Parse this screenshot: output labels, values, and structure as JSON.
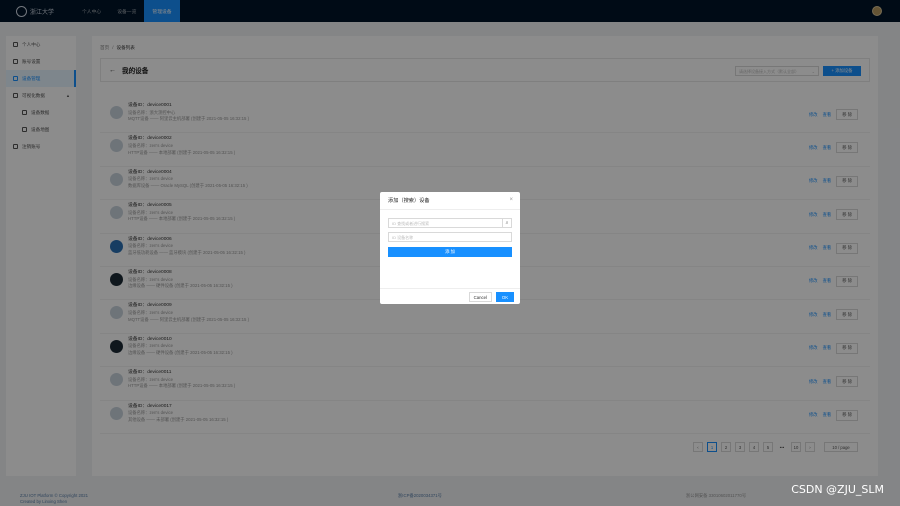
{
  "nav": {
    "logo_text": "浙江大学",
    "items": [
      "个人中心",
      "设备一览",
      "管理设备"
    ]
  },
  "sidebar": {
    "items": [
      {
        "label": "个人中心"
      },
      {
        "label": "账号设置"
      },
      {
        "label": "设备管理"
      },
      {
        "label": "可视化数据"
      },
      {
        "label": "设备数据"
      },
      {
        "label": "设备地图"
      },
      {
        "label": "注销账号"
      }
    ]
  },
  "breadcrumb": {
    "home": "首页",
    "sep": "/",
    "current": "设备列表"
  },
  "header": {
    "title": "我的设备",
    "select_placeholder": "请选择设备接入方式（默认全部）",
    "add_button": "+ 添加设备"
  },
  "device_rows": [
    {
      "title": "设备ID：device0001",
      "line1": "设备名称：浙大测控中心",
      "line2": "MQTT设备 —— 阿里云主机部署 (创建于 2021-05-05 16:32:15 )"
    },
    {
      "title": "设备ID：device0002",
      "line1": "设备名称：zen's device",
      "line2": "HTTP设备 —— 本地部署 (创建于 2021-05-05 16:32:15 )"
    },
    {
      "title": "设备ID：device0004",
      "line1": "设备名称：zen's device",
      "line2": "数据库设备 —— Oracle MySQL (创建于 2021-05-05 16:32:15 )"
    },
    {
      "title": "设备ID：device0005",
      "line1": "设备名称：zen's device",
      "line2": "HTTP设备 —— 本地部署 (创建于 2021-05-05 16:32:15 )"
    },
    {
      "title": "设备ID：device0006",
      "line1": "设备名称：zen's device",
      "line2": "蓝牙低功耗设备 —— 蓝牙模块 (创建于 2021-05-05 16:32:15 )"
    },
    {
      "title": "设备ID：device0008",
      "line1": "设备名称：zen's device",
      "line2": "边缘设备 —— 硬件设备 (创建于 2021-05-05 16:32:15 )"
    },
    {
      "title": "设备ID：device0009",
      "line1": "设备名称：zen's device",
      "line2": "MQTT设备 —— 阿里云主机部署 (创建于 2021-05-05 16:32:15 )"
    },
    {
      "title": "设备ID：device0010",
      "line1": "设备名称：zen's device",
      "line2": "边缘设备 —— 硬件设备 (创建于 2021-05-05 16:32:15 )"
    },
    {
      "title": "设备ID：device0011",
      "line1": "设备名称：zen's device",
      "line2": "HTTP设备 —— 本地部署 (创建于 2021-05-05 16:32:15 )"
    },
    {
      "title": "设备ID：device0017",
      "line1": "设备名称：zen's device",
      "line2": "其他设备 —— 未部署 (创建于 2021-05-05 16:32:15 )"
    }
  ],
  "row_actions": {
    "edit": "修改",
    "view": "查看",
    "delete": "移 除"
  },
  "pagination": {
    "prev": "‹",
    "pages": [
      "1",
      "2",
      "3",
      "4",
      "5"
    ],
    "dots": "•••",
    "last": "10",
    "next": "›",
    "page_size": "10 / page"
  },
  "footer": {
    "left_line1": "ZJU IOT Platform © Copyright 2021",
    "left_line2": "Created by Linxing Shen",
    "icp": "浙ICP备2020034371号",
    "police": "浙公网安备 33010602011770号"
  },
  "watermark": "CSDN @ZJU_SLM",
  "modal": {
    "title": "添加（搜索）设备",
    "close": "×",
    "search_placeholder": "ID 查找或者进行搜索",
    "input_placeholder": "ID 设备名称",
    "add_button": "添 加",
    "cancel": "Cancel",
    "ok": "OK"
  },
  "colors": {
    "primary": "#1890ff",
    "nav_bg": "#001529",
    "mask": "rgba(0,0,0,0.45)"
  }
}
